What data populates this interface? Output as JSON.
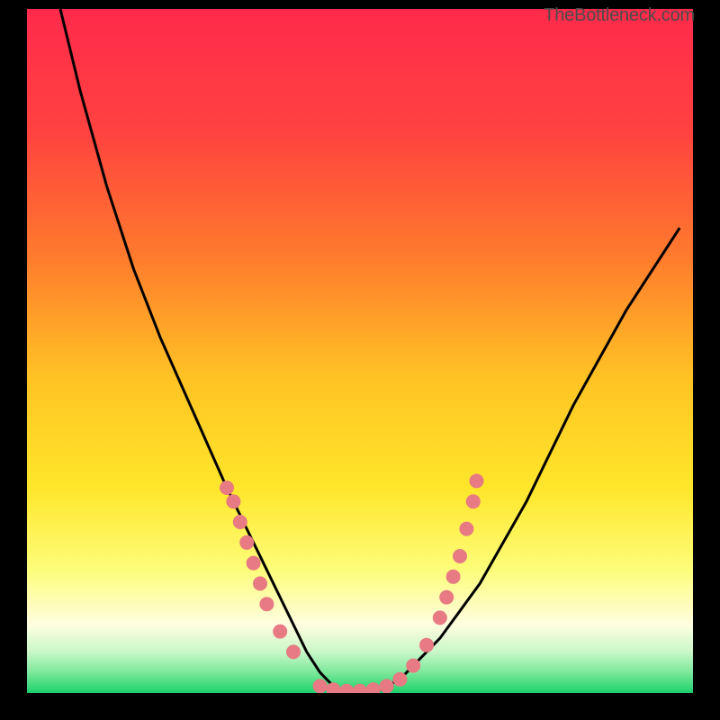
{
  "watermark": "TheBottleneck.com",
  "chart_data": {
    "type": "line",
    "title": "",
    "xlabel": "",
    "ylabel": "",
    "xlim": [
      0,
      100
    ],
    "ylim": [
      0,
      100
    ],
    "grid": false,
    "legend": false,
    "background": {
      "type": "vertical-gradient",
      "stops": [
        {
          "pos": 0.0,
          "color": "#ff2a4b"
        },
        {
          "pos": 0.18,
          "color": "#ff4240"
        },
        {
          "pos": 0.36,
          "color": "#ff7a2d"
        },
        {
          "pos": 0.54,
          "color": "#ffc324"
        },
        {
          "pos": 0.7,
          "color": "#ffe62a"
        },
        {
          "pos": 0.82,
          "color": "#fdfd7a"
        },
        {
          "pos": 0.9,
          "color": "#fffde0"
        },
        {
          "pos": 0.94,
          "color": "#c9f7c8"
        },
        {
          "pos": 0.97,
          "color": "#7be89a"
        },
        {
          "pos": 1.0,
          "color": "#1dd06a"
        }
      ]
    },
    "series": [
      {
        "name": "bottleneck-curve",
        "color": "#000000",
        "x": [
          5,
          8,
          12,
          16,
          20,
          25,
          30,
          33,
          36,
          38,
          40,
          42,
          44,
          46,
          48,
          50,
          52,
          54,
          56,
          58,
          62,
          68,
          75,
          82,
          90,
          98
        ],
        "y": [
          100,
          88,
          74,
          62,
          52,
          41,
          30,
          24,
          18,
          14,
          10,
          6,
          3,
          1,
          0,
          0,
          0,
          1,
          2,
          4,
          8,
          16,
          28,
          42,
          56,
          68
        ]
      }
    ],
    "markers": [
      {
        "name": "left-cluster",
        "color": "#e77a82",
        "radius": 8,
        "points": [
          {
            "x": 30,
            "y": 30
          },
          {
            "x": 31,
            "y": 28
          },
          {
            "x": 32,
            "y": 25
          },
          {
            "x": 33,
            "y": 22
          },
          {
            "x": 34,
            "y": 19
          },
          {
            "x": 35,
            "y": 16
          },
          {
            "x": 36,
            "y": 13
          },
          {
            "x": 38,
            "y": 9
          },
          {
            "x": 40,
            "y": 6
          }
        ]
      },
      {
        "name": "bottom-cluster",
        "color": "#e77a82",
        "radius": 8,
        "points": [
          {
            "x": 44,
            "y": 1
          },
          {
            "x": 46,
            "y": 0.5
          },
          {
            "x": 48,
            "y": 0.3
          },
          {
            "x": 50,
            "y": 0.3
          },
          {
            "x": 52,
            "y": 0.5
          },
          {
            "x": 54,
            "y": 1
          },
          {
            "x": 56,
            "y": 2
          }
        ]
      },
      {
        "name": "right-cluster",
        "color": "#e77a82",
        "radius": 8,
        "points": [
          {
            "x": 58,
            "y": 4
          },
          {
            "x": 60,
            "y": 7
          },
          {
            "x": 62,
            "y": 11
          },
          {
            "x": 63,
            "y": 14
          },
          {
            "x": 64,
            "y": 17
          },
          {
            "x": 65,
            "y": 20
          },
          {
            "x": 66,
            "y": 24
          },
          {
            "x": 67,
            "y": 28
          },
          {
            "x": 67.5,
            "y": 31
          }
        ]
      }
    ]
  }
}
